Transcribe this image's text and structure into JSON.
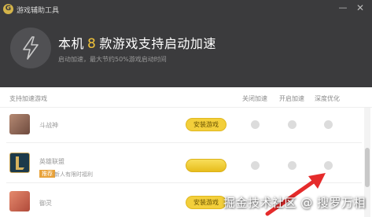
{
  "window": {
    "logo_letter": "G",
    "title": "游戏辅助工具",
    "minimize_glyph": "—",
    "close_glyph": "✕"
  },
  "banner": {
    "headline_prefix": "本机",
    "game_count": "8",
    "headline_suffix": "款游戏支持启动加速",
    "subtitle": "启动加速，最大节约50%游戏启动时间",
    "icon": "lightning-bolt-icon"
  },
  "table": {
    "col_game": "支持加速游戏",
    "col_disable": "关闭加速",
    "col_enable": "开启加速",
    "col_deep": "深度优化"
  },
  "games": [
    {
      "name": "斗战神",
      "button": "安装游戏",
      "icon": "douzhanshen-game-icon"
    },
    {
      "name": "英雄联盟",
      "tag": "推荐",
      "tag_note": "新人有限时福利",
      "button": "",
      "icon": "league-of-legends-game-icon"
    },
    {
      "name": "御灵",
      "button": "安装游戏",
      "icon": "yuling-game-icon"
    }
  ],
  "watermark": "掘金技术社区 @ 搜罗万相",
  "colors": {
    "header_bg": "#3b3b3d",
    "accent": "#f0c23a",
    "button": "#f3cf3b",
    "tag": "#e8a23a",
    "arrow": "#e52b2b"
  }
}
